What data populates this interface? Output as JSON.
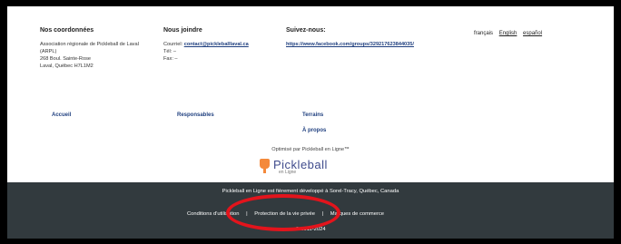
{
  "contact": {
    "title": "Nos coordonnées",
    "lines": [
      "Association régionale de Pickleball de Laval",
      "(ARPL)",
      "268 Boul. Sainte-Rose",
      "Laval, Québec H7L1M2"
    ]
  },
  "join": {
    "title": "Nous joindre",
    "email_label": "Courriel: ",
    "email": "contact@pickleballlaval.ca",
    "tel": "Tél: –",
    "fax": "Fax: –"
  },
  "follow": {
    "title": "Suivez-nous:",
    "link": "https://www.facebook.com/groups/329217623844035/"
  },
  "languages": [
    "français",
    "English",
    "español"
  ],
  "nav": {
    "accueil": "Accueil",
    "responsables": "Responsables",
    "terrains": "Terrains",
    "apropos": "À propos"
  },
  "optimise": "Optimisé par Pickleball en Ligne™",
  "logo": {
    "word": "Pickleball",
    "sub": "en Ligne"
  },
  "footer": {
    "developed": "Pickleball en Ligne est fièrement développé à Sorel-Tracy, Québec, Canada",
    "terms": "Conditions d'utilisation",
    "privacy": "Protection de la vie privée",
    "trademarks": "Marques de commerce",
    "separator": "|",
    "copyright": "© 2011-2024"
  },
  "colors": {
    "dark_footer": "#323a3e",
    "link": "#1f3f7f",
    "logo_orange": "#f4893b",
    "annotation_red": "#e3141c"
  }
}
